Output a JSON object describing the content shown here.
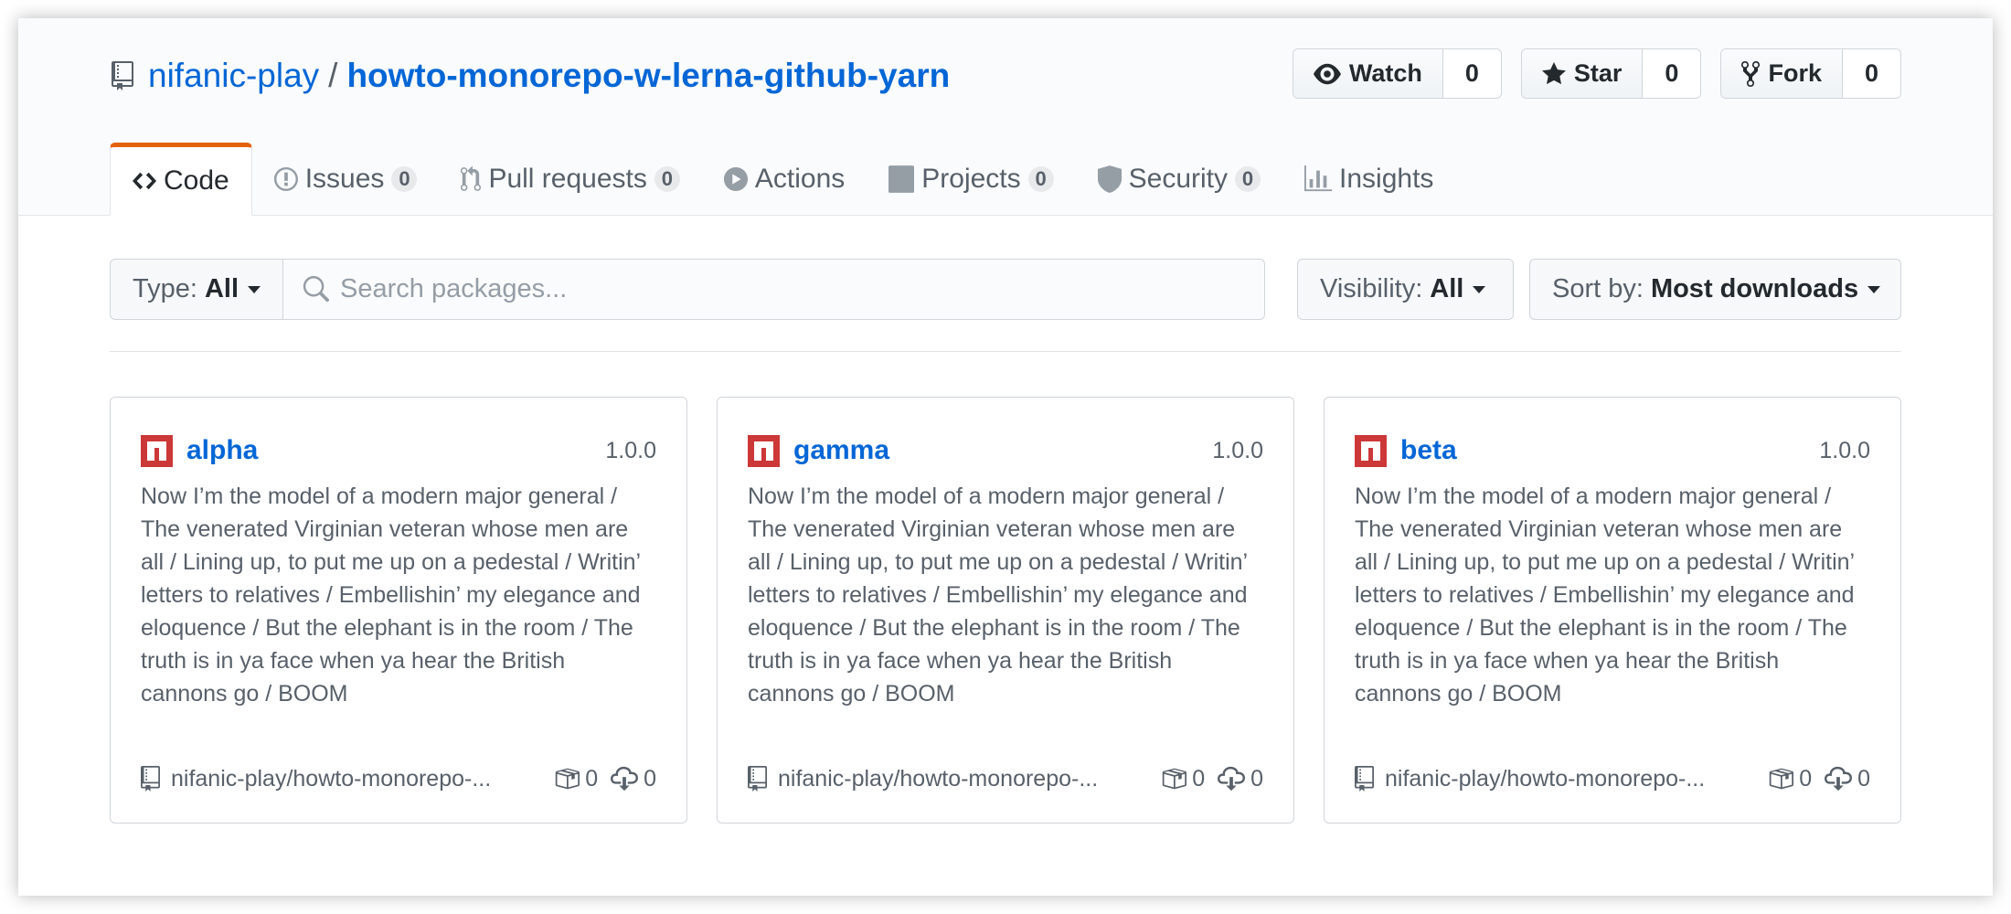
{
  "repo": {
    "owner": "nifanic-play",
    "separator": "/",
    "name": "howto-monorepo-w-lerna-github-yarn"
  },
  "actions": {
    "watch": {
      "label": "Watch",
      "count": "0"
    },
    "star": {
      "label": "Star",
      "count": "0"
    },
    "fork": {
      "label": "Fork",
      "count": "0"
    }
  },
  "tabs": [
    {
      "label": "Code",
      "icon": "code-icon",
      "selected": true
    },
    {
      "label": "Issues",
      "count": "0",
      "icon": "issue-icon"
    },
    {
      "label": "Pull requests",
      "count": "0",
      "icon": "pull-request-icon"
    },
    {
      "label": "Actions",
      "icon": "play-icon"
    },
    {
      "label": "Projects",
      "count": "0",
      "icon": "project-icon"
    },
    {
      "label": "Security",
      "count": "0",
      "icon": "shield-icon"
    },
    {
      "label": "Insights",
      "icon": "graph-icon"
    }
  ],
  "filters": {
    "type_label": "Type:",
    "type_value": "All",
    "search_placeholder": "Search packages...",
    "visibility_label": "Visibility:",
    "visibility_value": "All",
    "sort_label": "Sort by:",
    "sort_value": "Most downloads"
  },
  "packages": [
    {
      "name": "alpha",
      "version": "1.0.0",
      "description": "Now I’m the model of a modern major general / The venerated Virginian veteran whose men are all / Lining up, to put me up on a pedestal / Writin’ letters to relatives / Embellishin’ my elegance and eloquence / But the elephant is in the room / The truth is in ya face when ya hear the British cannons go / BOOM",
      "source": "nifanic-play/howto-monorepo-...",
      "packages_count": "0",
      "downloads": "0"
    },
    {
      "name": "gamma",
      "version": "1.0.0",
      "description": "Now I’m the model of a modern major general / The venerated Virginian veteran whose men are all / Lining up, to put me up on a pedestal / Writin’ letters to relatives / Embellishin’ my elegance and eloquence / But the elephant is in the room / The truth is in ya face when ya hear the British cannons go / BOOM",
      "source": "nifanic-play/howto-monorepo-...",
      "packages_count": "0",
      "downloads": "0"
    },
    {
      "name": "beta",
      "version": "1.0.0",
      "description": "Now I’m the model of a modern major general / The venerated Virginian veteran whose men are all / Lining up, to put me up on a pedestal / Writin’ letters to relatives / Embellishin’ my elegance and eloquence / But the elephant is in the room / The truth is in ya face when ya hear the British cannons go / BOOM",
      "source": "nifanic-play/howto-monorepo-...",
      "packages_count": "0",
      "downloads": "0"
    }
  ],
  "colors": {
    "link": "#0366d6",
    "tab_accent": "#e36209",
    "npm_red": "#cb3837",
    "muted_text": "#586069"
  }
}
